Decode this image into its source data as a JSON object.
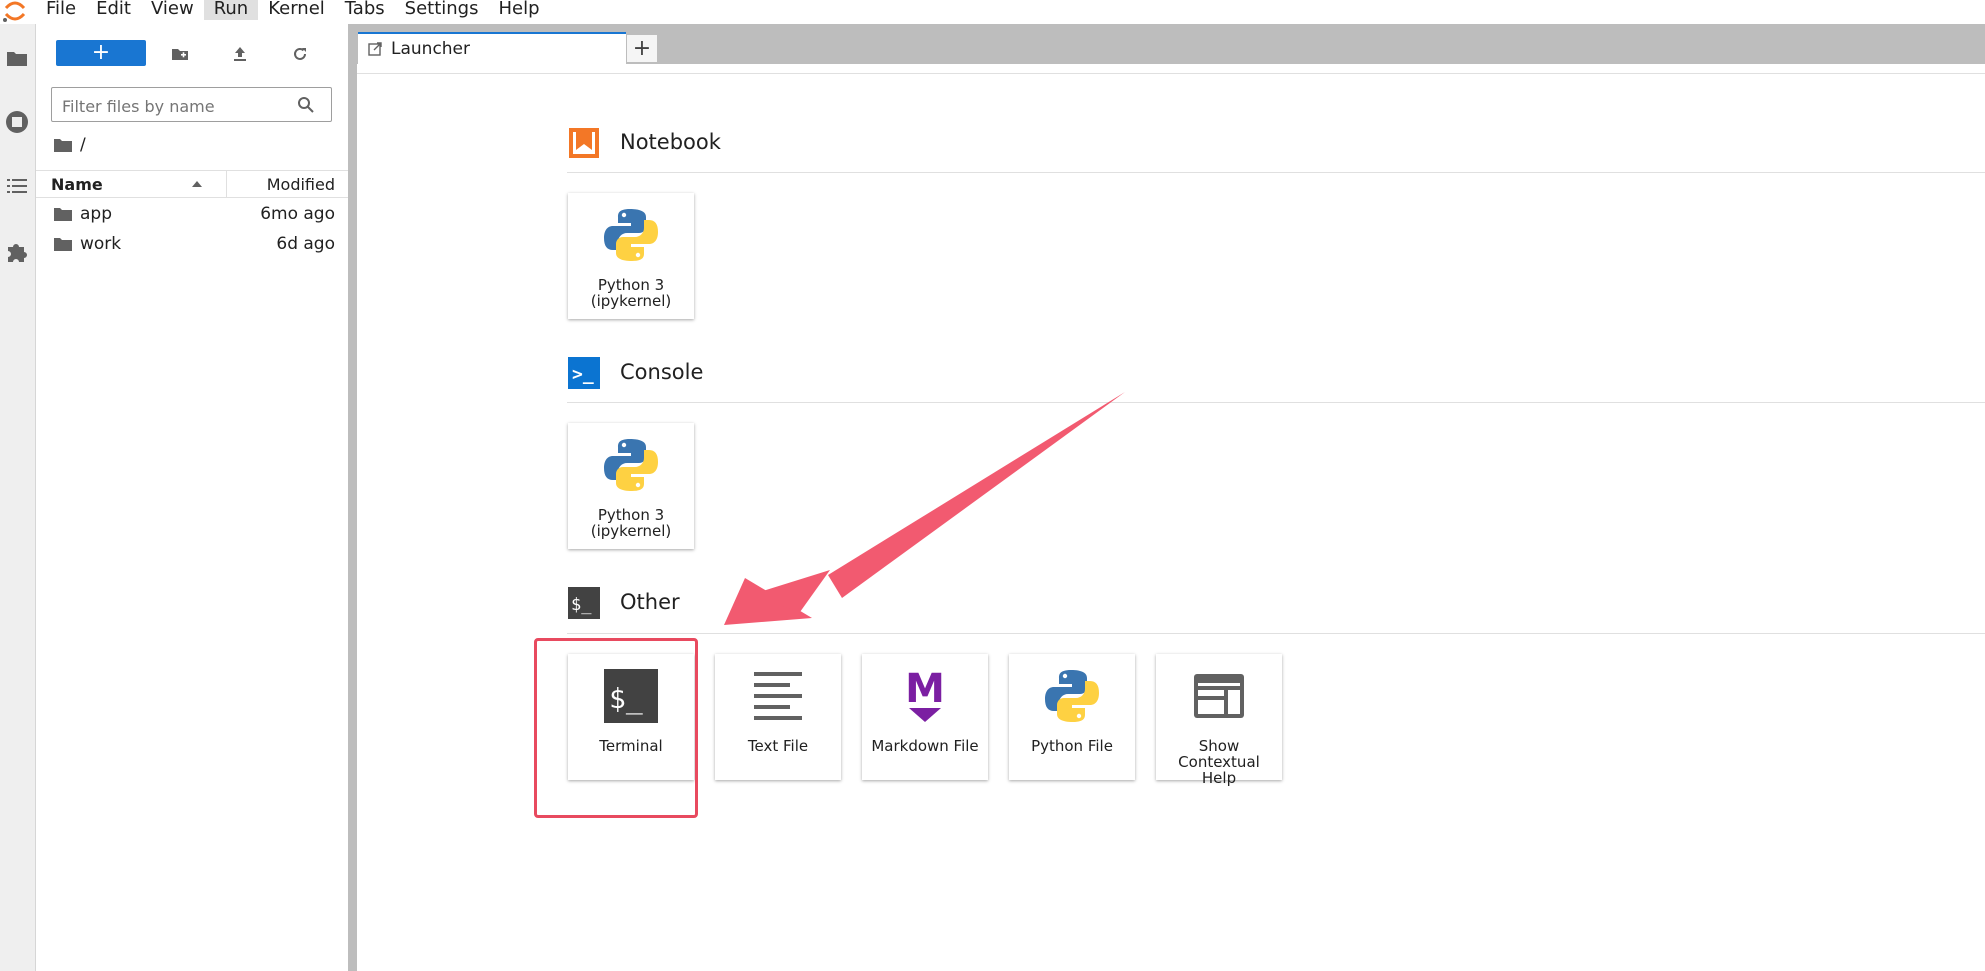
{
  "menubar": {
    "items": [
      "File",
      "Edit",
      "View",
      "Run",
      "Kernel",
      "Tabs",
      "Settings",
      "Help"
    ],
    "active_index": 3
  },
  "file_browser": {
    "new_button_label": "+",
    "filter_placeholder": "Filter files by name",
    "breadcrumb": "/",
    "columns": {
      "name": "Name",
      "modified": "Modified"
    },
    "files": [
      {
        "name": "app",
        "modified": "6mo ago"
      },
      {
        "name": "work",
        "modified": "6d ago"
      }
    ]
  },
  "tabs": {
    "launcher_label": "Launcher",
    "add_label": "+"
  },
  "launcher": {
    "notebook": {
      "title": "Notebook",
      "cards": [
        {
          "label_line1": "Python 3",
          "label_line2": "(ipykernel)"
        }
      ]
    },
    "console": {
      "title": "Console",
      "cards": [
        {
          "label_line1": "Python 3",
          "label_line2": "(ipykernel)"
        }
      ]
    },
    "other": {
      "title": "Other",
      "cards": [
        {
          "label": "Terminal"
        },
        {
          "label": "Text File"
        },
        {
          "label": "Markdown File"
        },
        {
          "label": "Python File"
        },
        {
          "label_lines": [
            "Show",
            "Contextual",
            "Help"
          ]
        }
      ]
    }
  },
  "icons": {
    "terminal_glyph": "$_",
    "console_glyph": ">_",
    "markdown_glyph": "M"
  },
  "colors": {
    "accent": "#1976d2",
    "notebook_orange": "#f37726",
    "markdown_purple": "#7b1fa2",
    "highlight_red": "#e84a5f"
  }
}
